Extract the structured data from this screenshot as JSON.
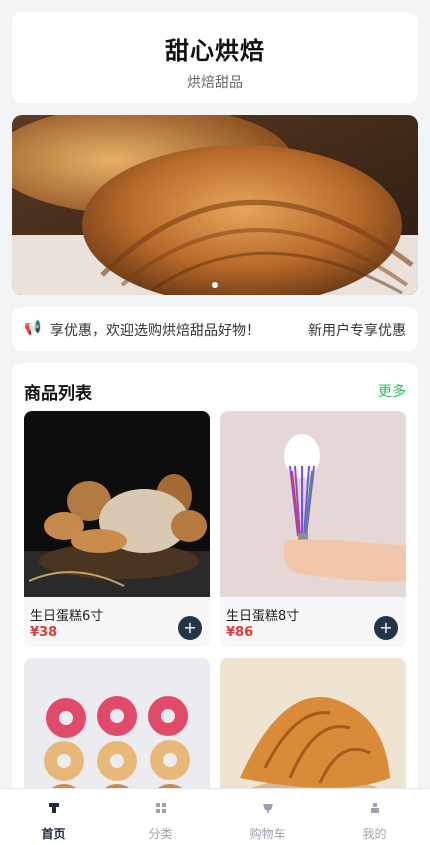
{
  "header": {
    "title": "甜心烘焙",
    "subtitle": "烘焙甜品"
  },
  "banner": {
    "image": "croissant-photo",
    "active_dot": 1,
    "dots": 1
  },
  "notice": {
    "icon": "speaker-icon",
    "text_part1": "享优惠，欢迎选购烘焙甜品好物！",
    "text_part2": "新用户专享优惠"
  },
  "products": {
    "title": "商品列表",
    "more": "更多",
    "items": [
      {
        "name": "生日蛋糕6寸",
        "price": "¥38",
        "image": "bread-basket-photo"
      },
      {
        "name": "生日蛋糕8寸",
        "price": "¥86",
        "image": "whisk-cream-photo"
      },
      {
        "name": "",
        "price": "",
        "image": "donuts-photo"
      },
      {
        "name": "",
        "price": "",
        "image": "croissant-photo"
      }
    ],
    "add_symbol": "+"
  },
  "tabbar": {
    "items": [
      {
        "label": "首页",
        "icon": "home-icon",
        "active": true
      },
      {
        "label": "分类",
        "icon": "grid-icon",
        "active": false
      },
      {
        "label": "购物车",
        "icon": "cart-icon",
        "active": false
      },
      {
        "label": "我的",
        "icon": "user-icon",
        "active": false
      }
    ]
  },
  "colors": {
    "accent": "#22c55e",
    "price": "#e53935",
    "button": "#243447",
    "background": "#f3f4f6"
  }
}
